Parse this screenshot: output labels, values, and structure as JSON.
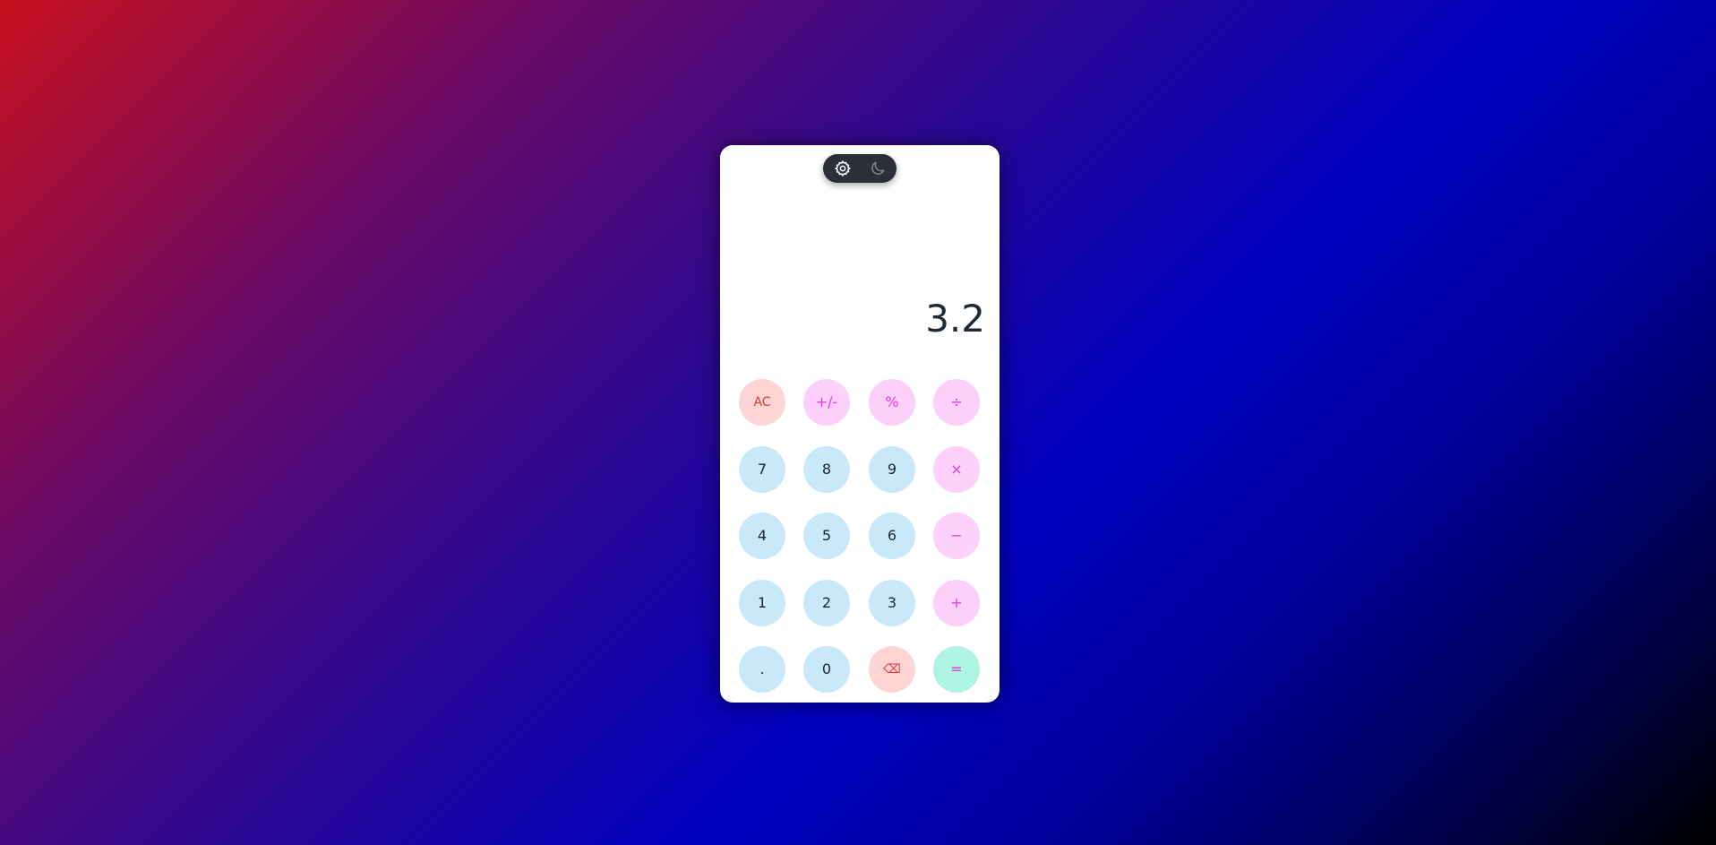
{
  "theme_toggle": {
    "light_icon": "gear-sun-icon",
    "dark_icon": "moon-icon"
  },
  "display": {
    "value": "3.2"
  },
  "keys": {
    "clear": "AC",
    "sign": "+/-",
    "percent": "%",
    "divide": "÷",
    "seven": "7",
    "eight": "8",
    "nine": "9",
    "multiply": "×",
    "four": "4",
    "five": "5",
    "six": "6",
    "subtract": "−",
    "one": "1",
    "two": "2",
    "three": "3",
    "add": "+",
    "decimal": ".",
    "zero": "0",
    "backspace": "⌫",
    "equals": "="
  },
  "colors": {
    "number_key": "#c9e9fb",
    "operator_key": "#fdd0fb",
    "operator_text": "#e040dc",
    "clear_key": "#ffd4d4",
    "clear_text": "#e23b3b",
    "equals_key": "#b0f5e3",
    "toggle_bg": "#2b2f3a"
  }
}
